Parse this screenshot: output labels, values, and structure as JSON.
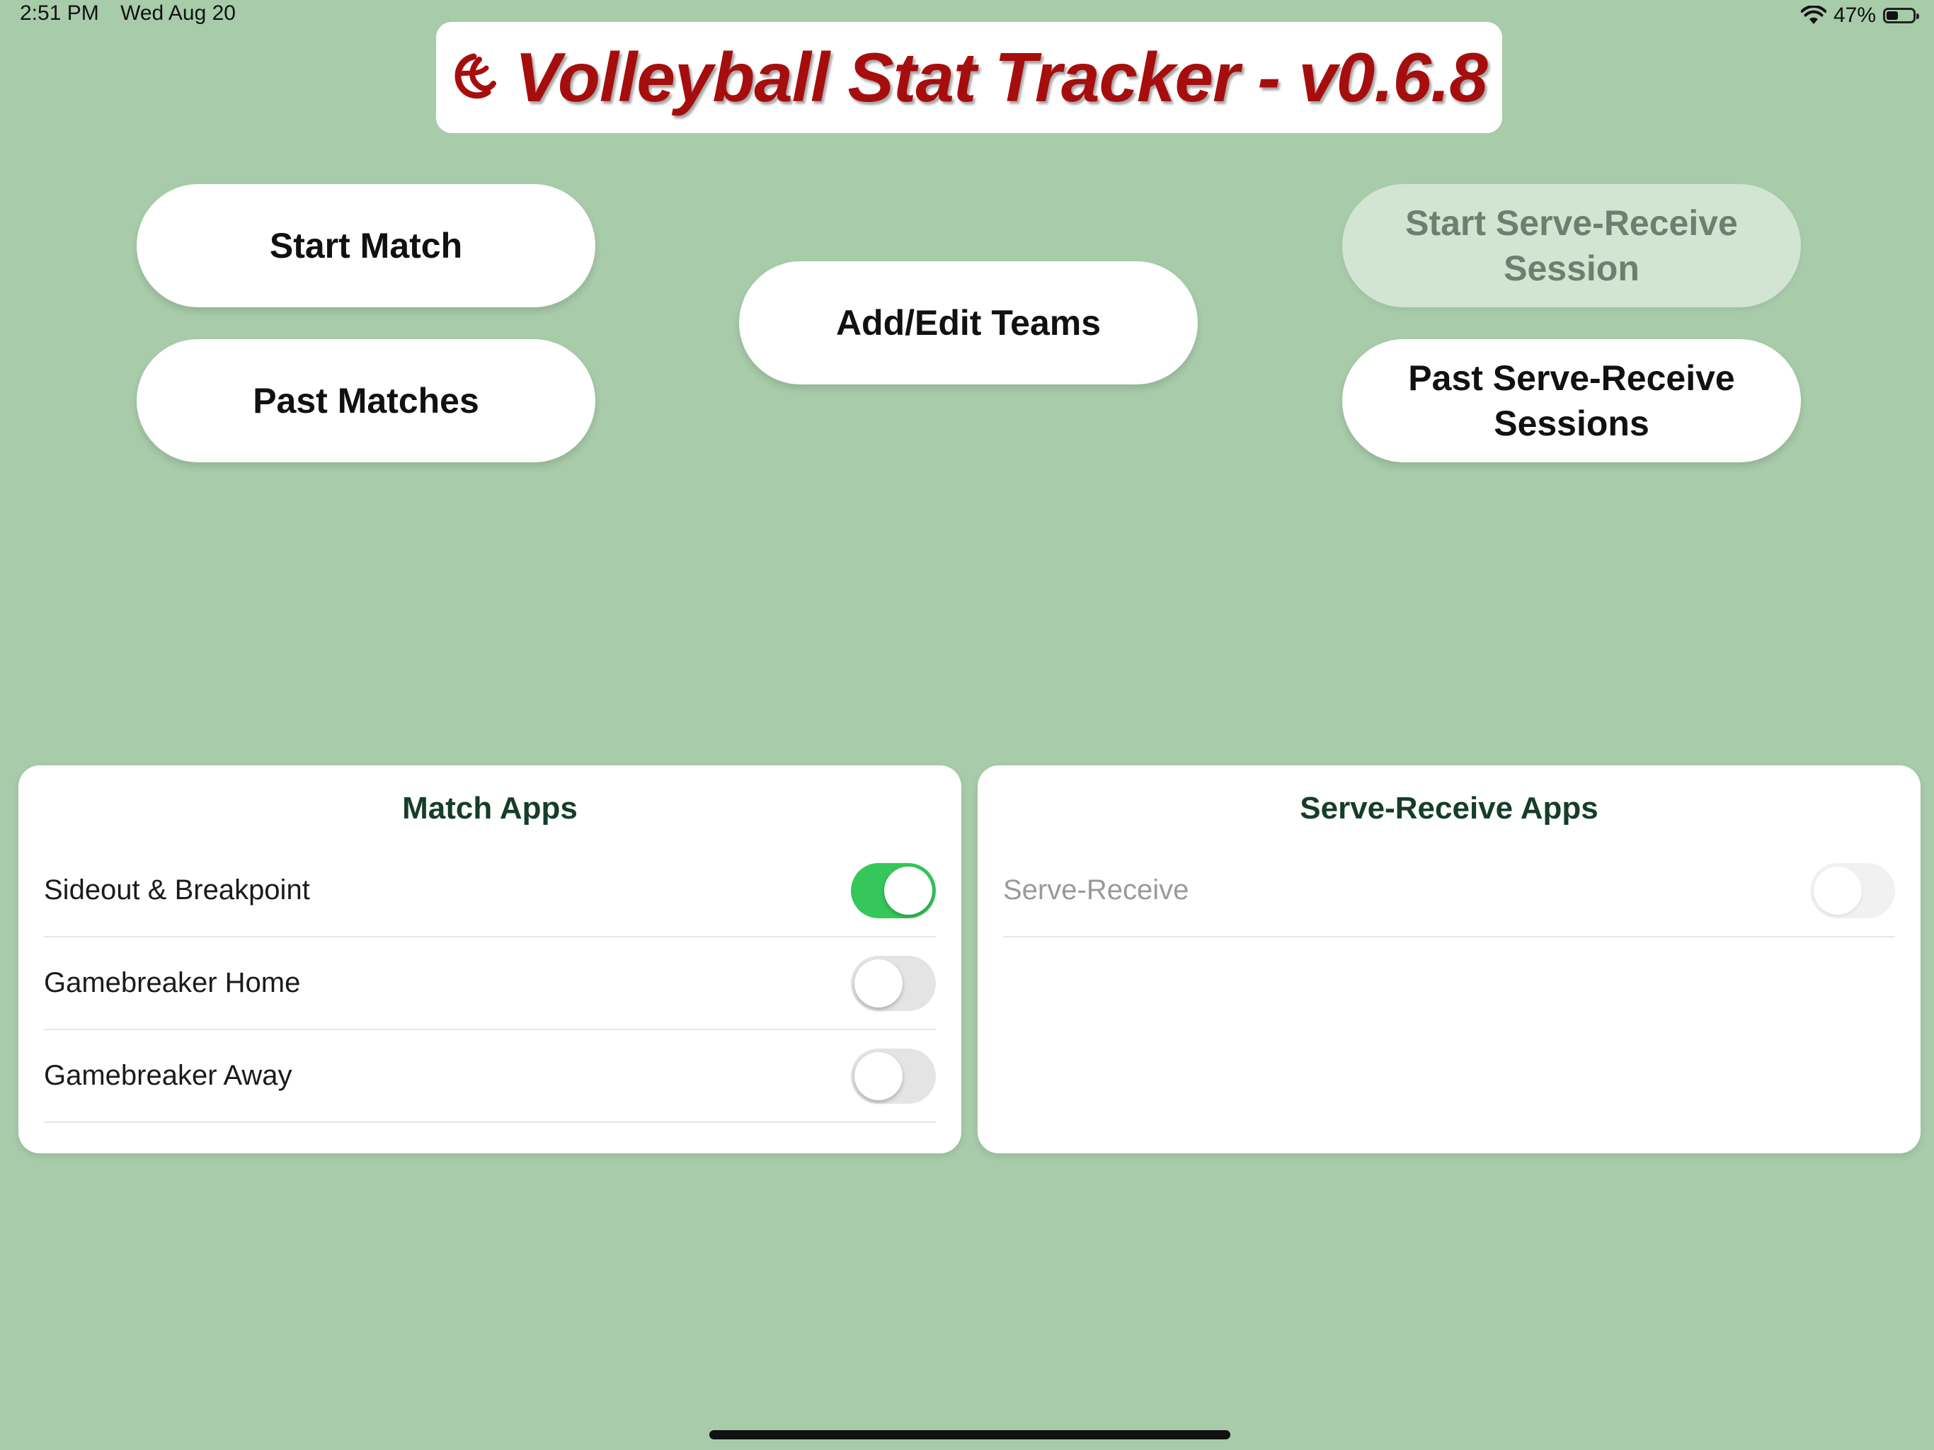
{
  "status_bar": {
    "time": "2:51 PM",
    "date": "Wed Aug 20",
    "battery_percent": "47%",
    "battery_level": 0.47,
    "wifi_icon": "wifi-icon"
  },
  "header": {
    "title": "Volleyball Stat Tracker - v0.6.8",
    "logo_icon": "volleyball-icon",
    "title_color": "#a60d0d"
  },
  "buttons": {
    "start_match": "Start Match",
    "past_matches": "Past Matches",
    "add_edit_teams": "Add/Edit Teams",
    "start_serve_receive": "Start Serve-Receive Session",
    "past_serve_receive": "Past Serve-Receive Sessions"
  },
  "match_apps": {
    "title": "Match Apps",
    "items": [
      {
        "label": "Sideout & Breakpoint",
        "enabled": true
      },
      {
        "label": "Gamebreaker Home",
        "enabled": false
      },
      {
        "label": "Gamebreaker Away",
        "enabled": false
      }
    ]
  },
  "serve_receive_apps": {
    "title": "Serve-Receive Apps",
    "items": [
      {
        "label": "Serve-Receive",
        "enabled": false,
        "disabled": true
      }
    ]
  },
  "colors": {
    "background": "#a8cbaa",
    "toggle_on": "#35c759",
    "panel_title": "#153d2a"
  }
}
